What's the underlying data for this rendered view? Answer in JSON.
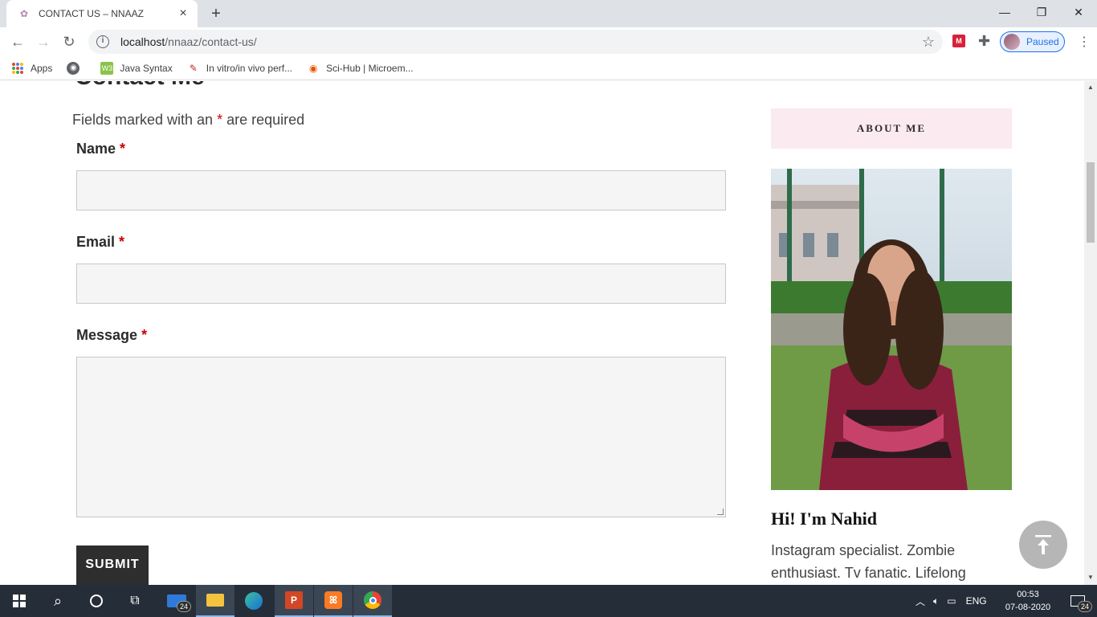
{
  "browser": {
    "tab_title": "CONTACT US – NNAAZ",
    "url_host": "localhost",
    "url_path": "/nnaaz/contact-us/",
    "profile_status": "Paused",
    "bookmarks": [
      {
        "label": "Apps",
        "icon": "apps-grid-icon"
      },
      {
        "label": "",
        "icon": "globe-icon"
      },
      {
        "label": "Java Syntax",
        "icon": "java-icon"
      },
      {
        "label": "In vitro/in vivo perf...",
        "icon": "science-icon"
      },
      {
        "label": "Sci-Hub | Microem...",
        "icon": "eye-icon"
      }
    ]
  },
  "page": {
    "heading": "Contact Me",
    "required_note_before": "Fields marked with an ",
    "required_star": "*",
    "required_note_after": " are required",
    "fields": {
      "name_label": "Name",
      "email_label": "Email",
      "message_label": "Message",
      "name_value": "",
      "email_value": "",
      "message_value": ""
    },
    "submit_label": "SUBMIT"
  },
  "sidebar": {
    "about_title": "ABOUT ME",
    "bio_title": "Hi! I'm Nahid",
    "bio_text": "Instagram specialist. Zombie enthusiast. Tv fanatic. Lifelong"
  },
  "taskbar": {
    "mail_badge": "24",
    "language": "ENG",
    "time": "00:53",
    "date": "07-08-2020",
    "notification_count": "24"
  },
  "colors": {
    "accent_pink": "#fbeaf0",
    "required_red": "#cc0000",
    "submit_bg": "#2e2e2e"
  }
}
